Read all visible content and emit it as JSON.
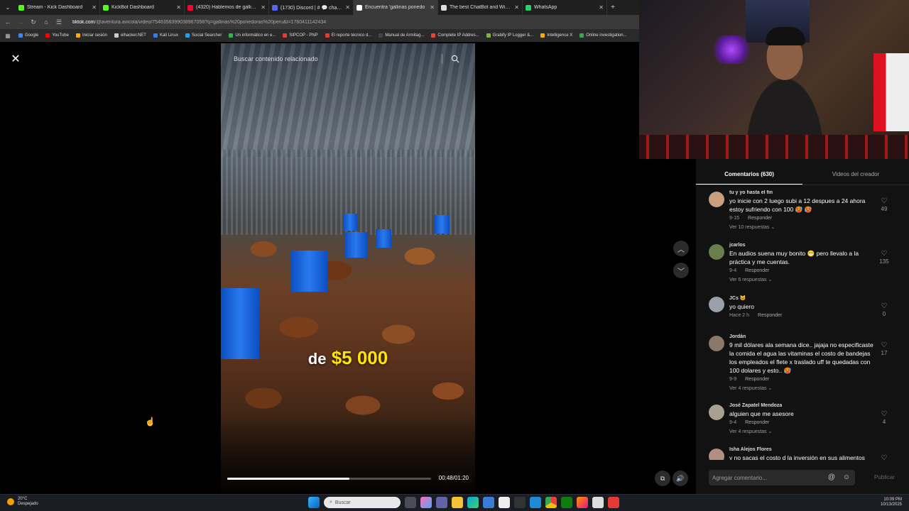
{
  "browser": {
    "tabs": [
      {
        "label": "Stream - Kick Dashboard",
        "color": "#53fc18",
        "active": false
      },
      {
        "label": "KickBot Dashboard",
        "color": "#53fc18",
        "active": false
      },
      {
        "label": "(4320) Hablemos de gallinas \"C",
        "color": "#ff0033",
        "active": false
      },
      {
        "label": "(1730) Discord | # 💬 chat-gene",
        "color": "#5865f2",
        "active": false
      },
      {
        "label": "Encuentra 'gallinas ponedo",
        "color": "#ffffff",
        "active": true
      },
      {
        "label": "The best ChatBot and Widgets",
        "color": "#dddddd",
        "active": false
      },
      {
        "label": "WhatsApp",
        "color": "#25d366",
        "active": false
      }
    ],
    "url_host": "tiktok.com",
    "url_path": "/@aventura.avicola/video/7546358399038967058?q=gallinas%20ponedoras%20peru&t=1760411142434",
    "bookmarks": [
      {
        "label": "Google",
        "color": "#4285f4"
      },
      {
        "label": "YouTube",
        "color": "#ff0000"
      },
      {
        "label": "Iniciar sesión",
        "color": "#f9ab00"
      },
      {
        "label": "elhacker.NET",
        "color": "#cccccc"
      },
      {
        "label": "Kali Linux",
        "color": "#367bf0"
      },
      {
        "label": "Social Searcher",
        "color": "#1da1f2"
      },
      {
        "label": "Un informático en e...",
        "color": "#2db84d"
      },
      {
        "label": "SIPCOP - PNP",
        "color": "#e53935"
      },
      {
        "label": "El reporte técnico d...",
        "color": "#e53935"
      },
      {
        "label": "Manual de Armitag...",
        "color": "#444444"
      },
      {
        "label": "Complete IP Addres...",
        "color": "#ea4335"
      },
      {
        "label": "Grabify IP Logger &...",
        "color": "#7cb342"
      },
      {
        "label": "Intelligence X",
        "color": "#f9ab00"
      },
      {
        "label": "Online investigation...",
        "color": "#34a853"
      }
    ]
  },
  "video": {
    "search_placeholder": "Buscar contenido relacionado",
    "caption_pre": "de",
    "caption_amount": "$5 000",
    "time": "00:48/01:20",
    "progress": 0.6
  },
  "comments_panel": {
    "tab_comments": "Comentarios (630)",
    "tab_creator": "Videos del creador",
    "composer_placeholder": "Agregar comentario...",
    "publish_label": "Publicar",
    "comments": [
      {
        "user": "tu y yo hasta el fin",
        "text": "yo inicie con 2 luego subi a 12 despues a 24 ahora estoy sufriendo con 100 🥵 🥵",
        "date": "9-15",
        "reply": "Responder",
        "replies": "Ver 10 respuestas ⌄",
        "likes": "49",
        "avatar": "#c8a080"
      },
      {
        "user": "jcarlos",
        "text": "En audios suena muy bonito 😁 pero llevalo a la práctica y me cuentas.",
        "date": "9-4",
        "reply": "Responder",
        "replies": "Ver 6 respuestas ⌄",
        "likes": "135",
        "avatar": "#6b7d4a"
      },
      {
        "user": "JCs 🐱",
        "text": "yo quiero",
        "date": "Hace 2 h",
        "reply": "Responder",
        "replies": "",
        "likes": "0",
        "avatar": "#9aa0a8"
      },
      {
        "user": "Jordán",
        "text": "9 mil dólares ala semana dice.. jajaja no especificaste la comida el agua las vitaminas el costo de bandejas los empleados el flete x traslado uff te quedadas con 100 dolares y esto.. 🥵",
        "date": "9-9",
        "reply": "Responder",
        "replies": "Ver 4 respuestas ⌄",
        "likes": "17",
        "avatar": "#8a7868"
      },
      {
        "user": "José Zapatel Mendoza",
        "text": "alguien que me asesore",
        "date": "9-4",
        "reply": "Responder",
        "replies": "Ver 4 respuestas ⌄",
        "likes": "4",
        "avatar": "#a8a090"
      },
      {
        "user": "Isha Alejos Flores",
        "text": "y no sacas el costo d la inversión en sus alimentos",
        "date": "",
        "reply": "",
        "replies": "",
        "likes": "",
        "avatar": "#b09080"
      }
    ]
  },
  "taskbar": {
    "temp": "20°C",
    "weather": "Despejado",
    "search_label": "Buscar",
    "time": "10:09 PM",
    "date": "10/13/2025"
  }
}
